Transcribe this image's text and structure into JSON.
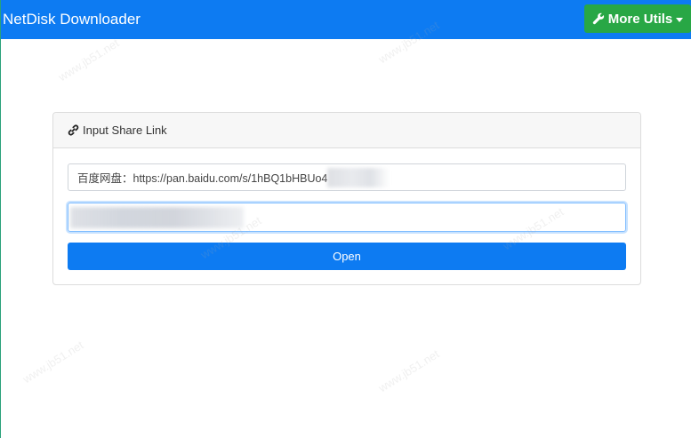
{
  "navbar": {
    "brand": "NetDisk Downloader",
    "utils_label": "More Utils",
    "accent_color": "#0d7bf2",
    "utils_color": "#28a745"
  },
  "card": {
    "header_title": "Input Share Link",
    "link_field": {
      "value": "百度网盘：https://pan.baidu.com/s/1hBQ1bHBUo4"
    },
    "code_field": {
      "value": ""
    },
    "open_label": "Open"
  },
  "icons": {
    "utils": "wrench-icon",
    "header": "link-icon",
    "dropdown": "caret-down-icon"
  }
}
